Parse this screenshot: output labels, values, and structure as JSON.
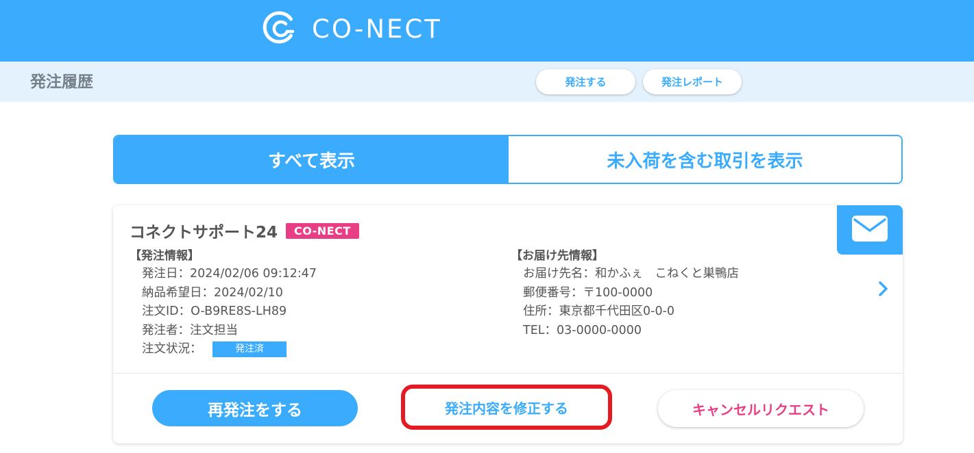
{
  "header": {
    "brand": "CO-NECT",
    "logo_icon": "conect-logo-icon",
    "color": "#3aabfd"
  },
  "subheader": {
    "title": "発注履歴",
    "order_button": "発注する",
    "report_button": "発注レポート"
  },
  "tabs": [
    {
      "label": "すべて表示",
      "active": true
    },
    {
      "label": "未入荷を含む取引を表示",
      "active": false
    }
  ],
  "order": {
    "supplier_name": "コネクトサポート24",
    "supplier_tag": "CO-NECT",
    "order_info_heading": "【発注情報】",
    "order_date": "発注日：2024/02/06 09:12:47",
    "desired_delivery_date": "納品希望日：2024/02/10",
    "order_id": "注文ID：O-B9RE8S-LH89",
    "orderer": "発注者：注文担当",
    "status_label": "注文状況：",
    "status_value": "発注済",
    "delivery_heading": "【お届け先情報】",
    "recipient": "お届け先名：和かふぇ　こねくと巣鴨店",
    "postal_code": "郵便番号：〒100-0000",
    "address": "住所：東京都千代田区0-0-0",
    "tel": "TEL：03-0000-0000",
    "mail_icon": "envelope-icon",
    "detail_icon": "chevron-right-icon"
  },
  "actions": {
    "reorder": "再発注をする",
    "modify": "発注内容を修正する",
    "cancel": "キャンセルリクエスト"
  },
  "colors": {
    "primary": "#3aabfd",
    "accent": "#e83e86",
    "highlight": "#e31c23"
  }
}
